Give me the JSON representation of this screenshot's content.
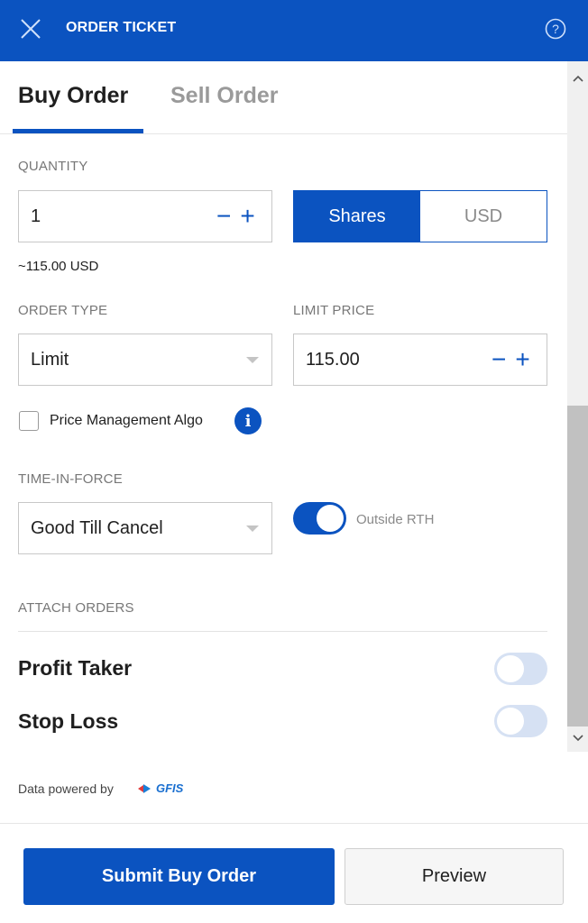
{
  "header": {
    "title": "ORDER TICKET"
  },
  "tabs": [
    {
      "label": "Buy Order",
      "active": true
    },
    {
      "label": "Sell Order",
      "active": false
    }
  ],
  "quantity": {
    "label": "QUANTITY",
    "value": "1",
    "unit_options": [
      "Shares",
      "USD"
    ],
    "selected_unit": "Shares",
    "estimate": "~115.00 USD"
  },
  "order_type": {
    "label": "ORDER TYPE",
    "value": "Limit"
  },
  "limit_price": {
    "label": "LIMIT PRICE",
    "value": "115.00"
  },
  "algo": {
    "label": "Price Management Algo",
    "checked": false
  },
  "time_in_force": {
    "label": "TIME-IN-FORCE",
    "value": "Good Till Cancel"
  },
  "outside_rth": {
    "label": "Outside RTH",
    "enabled": true
  },
  "attach_orders": {
    "label": "ATTACH ORDERS",
    "items": [
      {
        "label": "Profit Taker",
        "enabled": false
      },
      {
        "label": "Stop Loss",
        "enabled": false
      }
    ]
  },
  "attribution": {
    "text": "Data powered by",
    "brand": "GFIS"
  },
  "actions": {
    "submit_label": "Submit Buy Order",
    "preview_label": "Preview"
  },
  "colors": {
    "primary": "#0b53c0",
    "toggle_off": "#d6e1f3"
  }
}
